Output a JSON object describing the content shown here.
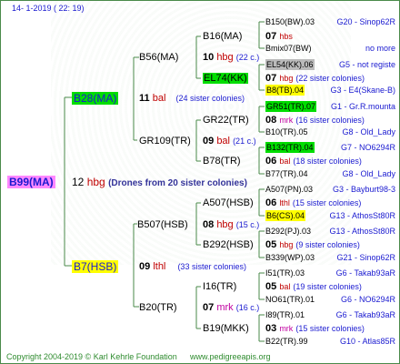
{
  "header": {
    "date": "14-  1-2019 (  22:  19)"
  },
  "root": {
    "name": "B99(MA)",
    "gen": "12",
    "race": "hbg",
    "note": "(Drones from 20 sister colonies)"
  },
  "g1": [
    {
      "name": "B28(MA)",
      "gen": "11",
      "race": "bal",
      "note": "(24 sister colonies)"
    },
    {
      "name": "B7(HSB)",
      "gen": "09",
      "race": "lthl",
      "note": "(33 sister colonies)"
    }
  ],
  "g2": [
    {
      "name": "B56(MA)",
      "gen": "10",
      "race": "hbg",
      "note": "(22 c.)"
    },
    {
      "name": "GR109(TR)",
      "gen": "09",
      "race": "bal",
      "note": "(21 c.)"
    },
    {
      "name": "B507(HSB)",
      "gen": "08",
      "race": "hbg",
      "note": "(15 c.)"
    },
    {
      "name": "B20(TR)",
      "gen": "07",
      "race": "mrk",
      "note": "(16 c.)"
    }
  ],
  "g3": [
    {
      "name": "B16(MA)",
      "gen": "07",
      "race": "hbs",
      "note": ""
    },
    {
      "name": "EL74(KK)",
      "gen": "07",
      "race": "hbg",
      "note": "(22 sister colonies)"
    },
    {
      "name": "GR22(TR)",
      "gen": "08",
      "race": "mrk",
      "note": "(16 sister colonies)"
    },
    {
      "name": "B78(TR)",
      "gen": "06",
      "race": "bal",
      "note": "(18 sister colonies)"
    },
    {
      "name": "A507(HSB)",
      "gen": "06",
      "race": "lthl",
      "note": "(15 sister colonies)"
    },
    {
      "name": "B292(HSB)",
      "gen": "05",
      "race": "hbg",
      "note": "(9 sister colonies)"
    },
    {
      "name": "I16(TR)",
      "gen": "05",
      "race": "bal",
      "note": "(19 sister colonies)"
    },
    {
      "name": "B19(MKK)",
      "gen": "03",
      "race": "mrk",
      "note": "(15 sister colonies)"
    }
  ],
  "g4": [
    {
      "name": "B150(BW).03",
      "info": "G20 - Sinop62R"
    },
    {
      "name": "Bmix07(BW)",
      "info": "no more"
    },
    {
      "name": "EL54(KK).06",
      "info": "G5 - not registe"
    },
    {
      "name": "B8(TB).04",
      "info": "G3 - E4(Skane-B)"
    },
    {
      "name": "GR51(TR).07",
      "info": "G1 - Gr.R.mounta"
    },
    {
      "name": "B10(TR).05",
      "info": "G8 - Old_Lady"
    },
    {
      "name": "B132(TR).04",
      "info": "G7 - NO6294R"
    },
    {
      "name": "B77(TR).04",
      "info": "G8 - Old_Lady"
    },
    {
      "name": "A507(PN).03",
      "info": "G3 - Bayburt98-3"
    },
    {
      "name": "B6(CS).04",
      "info": "G13 - AthosSt80R"
    },
    {
      "name": "B292(PJ).03",
      "info": "G13 - AthosSt80R"
    },
    {
      "name": "B339(WP).03",
      "info": "G21 - Sinop62R"
    },
    {
      "name": "I51(TR).03",
      "info": "G6 - Takab93aR"
    },
    {
      "name": "NO61(TR).01",
      "info": "G6 - NO6294R"
    },
    {
      "name": "I89(TR).01",
      "info": "G6 - Takab93aR"
    },
    {
      "name": "B22(TR).99",
      "info": "G10 - Atlas85R"
    }
  ],
  "footer": {
    "copyright": "Copyright 2004-2019 © Karl Kehrle Foundation",
    "url": "www.pedigreeapis.org"
  },
  "colors": {
    "line": "#4a8a4a",
    "blue": "#1a1ad0",
    "red": "#c00000",
    "pink_bg": "#ff88ff",
    "yellow_bg": "#ffff00",
    "green_bg": "#00dd00",
    "lime_bg": "#66ee66",
    "gray_bg": "#bbbbbb"
  }
}
